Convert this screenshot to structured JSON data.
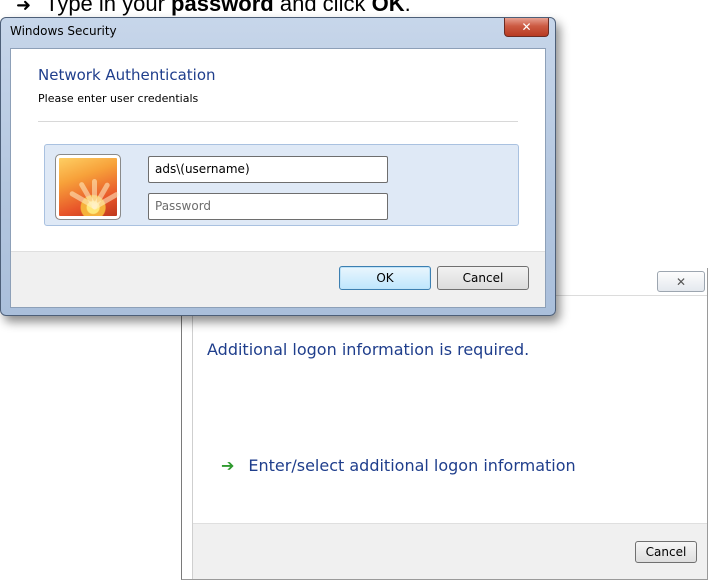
{
  "instruction": {
    "prefix": "Type in your ",
    "bold1": "password",
    "middle": " and click ",
    "bold2": "OK",
    "suffix": "."
  },
  "security_dialog": {
    "title": "Windows Security",
    "heading": "Network Authentication",
    "subheading": "Please enter user credentials",
    "username_value": "ads\\(username)",
    "password_placeholder": "Password",
    "ok_label": "OK",
    "cancel_label": "Cancel"
  },
  "logon_dialog": {
    "heading": "Additional logon information is required.",
    "link_label": "Enter/select additional logon information",
    "cancel_label": "Cancel"
  },
  "icons": {
    "bullet": "right-arrow-bullet-icon",
    "close": "close-icon",
    "link_arrow": "green-arrow-icon",
    "avatar": "user-avatar-flower"
  }
}
